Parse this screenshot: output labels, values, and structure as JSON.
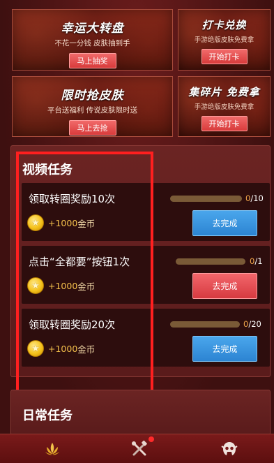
{
  "promos": {
    "lucky_wheel": {
      "title": "幸运大转盘",
      "subtitle": "不花一分钱 皮肤抽到手",
      "button": "马上抽奖"
    },
    "checkin": {
      "title": "打卡兑换",
      "subtitle": "手游绝版皮肤免费拿",
      "button": "开始打卡"
    },
    "skin_grab": {
      "title": "限时抢皮肤",
      "subtitle": "平台送福利 传说皮肤限时送",
      "button": "马上去抢"
    },
    "shards": {
      "title": "集碎片 免费拿",
      "subtitle": "手游绝版皮肤免费拿",
      "button": "开始打卡"
    }
  },
  "video_tasks": {
    "title": "视频任务",
    "tasks": [
      {
        "name": "领取转圈奖励10次",
        "reward_amount": "+1000",
        "reward_unit": "金币",
        "progress_done": "0",
        "progress_total": "/10",
        "progress_fraction": 0,
        "button": "去完成",
        "button_color": "#3b95e0"
      },
      {
        "name": "点击“全都要”按钮1次",
        "reward_amount": "+1000",
        "reward_unit": "金币",
        "progress_done": "0",
        "progress_total": "/1",
        "progress_fraction": 0,
        "button": "去完成",
        "button_color": "#e24c51"
      },
      {
        "name": "领取转圈奖励20次",
        "reward_amount": "+1000",
        "reward_unit": "金币",
        "progress_done": "0",
        "progress_total": "/20",
        "progress_fraction": 0,
        "button": "去完成",
        "button_color": "#3b95e0"
      }
    ]
  },
  "daily_tasks": {
    "title": "日常任务"
  },
  "icons": {
    "coin": "star-coin-icon",
    "nav": [
      "lotus-icon",
      "tools-icon",
      "skin-helmet-icon"
    ]
  },
  "colors": {
    "highlight": "#ff1f1f",
    "coin_text": "#f4c04b",
    "button_blue": "#3b95e0",
    "button_red": "#e24c51"
  }
}
